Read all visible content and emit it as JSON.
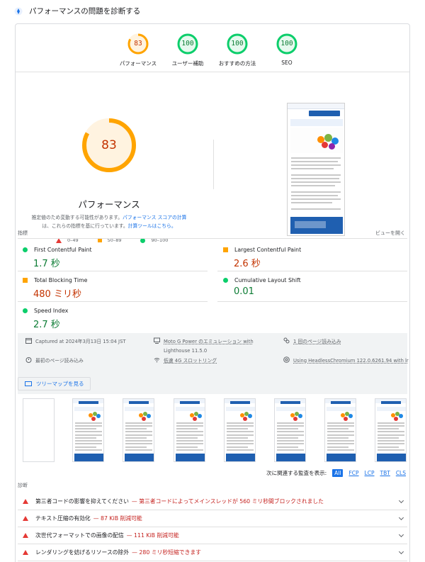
{
  "header": {
    "title": "パフォーマンスの問題を診断する"
  },
  "scores": [
    {
      "label": "パフォーマンス",
      "value": "83",
      "level": 0.83,
      "rating": "average"
    },
    {
      "label": "ユーザー補助",
      "value": "100",
      "level": 1.0,
      "rating": "pass"
    },
    {
      "label": "おすすめの方法",
      "value": "100",
      "level": 1.0,
      "rating": "pass"
    },
    {
      "label": "SEO",
      "value": "100",
      "level": 1.0,
      "rating": "pass"
    }
  ],
  "performance": {
    "score": "83",
    "title": "パフォーマンス",
    "desc_prefix": "推定値のため変動する可能性があります。",
    "desc_link1": "パフォーマンス スコアの計算",
    "desc_middle": "は、これらの指標を基に行っています。",
    "desc_link2": "計算ツールはこちら。"
  },
  "legend": {
    "fail": "0–49",
    "average": "50–89",
    "pass": "90–100"
  },
  "metrics_section": {
    "label": "指標",
    "expand": "ビューを開く"
  },
  "metrics": {
    "fcp": {
      "label": "First Contentful Paint",
      "value": "1.7 秒"
    },
    "lcp": {
      "label": "Largest Contentful Paint",
      "value": "2.6 秒"
    },
    "tbt": {
      "label": "Total Blocking Time",
      "value": "480 ミリ秒"
    },
    "cls": {
      "label": "Cumulative Layout Shift",
      "value": "0.01"
    },
    "si": {
      "label": "Speed Index",
      "value": "2.7 秒"
    }
  },
  "environment": {
    "captured": "Captured at 2024年3月13日 15:04 JST",
    "device_line1": "Moto G Power のエミュレーション with",
    "device_line2": "Lighthouse 11.5.0",
    "session": "1 回のページ読み込み",
    "initial": "最初のページ読み込み",
    "throttle": "低速 4G スロットリング",
    "browser": "Using HeadlessChromium 122.0.6261.94 with lr"
  },
  "treemap": {
    "label": "ツリーマップを見る"
  },
  "filters": {
    "prefix": "次に関連する監査を表示:",
    "all": "All",
    "fcp": "FCP",
    "lcp": "LCP",
    "tbt": "TBT",
    "cls": "CLS"
  },
  "diagnostics": {
    "label": "診断",
    "items": [
      {
        "title": "第三者コードの影響を抑えてください",
        "detail": "— 第三者コードによってメインスレッドが 560 ミリ秒間ブロックされました"
      },
      {
        "title": "テキスト圧縮の有効化",
        "detail": "— 87 KiB 削減可能"
      },
      {
        "title": "次世代フォーマットでの画像の配信",
        "detail": "— 111 KiB 削減可能"
      },
      {
        "title": "レンダリングを妨げるリソースの除外",
        "detail": "— 280 ミリ秒短縮できます"
      }
    ]
  },
  "colors": {
    "pass": "#0cce6b",
    "average": "#ffa400",
    "fail": "#ff4e42",
    "link": "#1a73e8"
  }
}
